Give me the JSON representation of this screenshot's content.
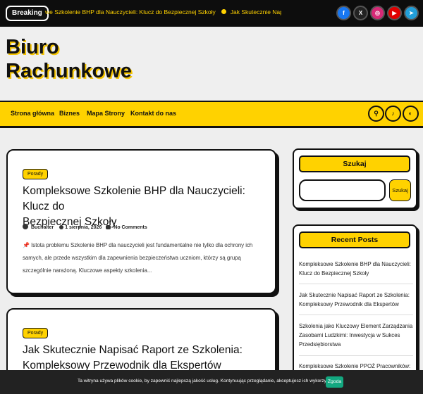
{
  "topbar": {
    "breaking_label": "Breaking",
    "ticker_items": [
      "we Szkolenie BHP dla Nauczycieli: Klucz do Bezpiecznej Szkoły",
      "Jak Skutecznie Napisać Rap"
    ],
    "socials": [
      {
        "name": "facebook",
        "glyph": "f",
        "color": "#1877f2"
      },
      {
        "name": "x",
        "glyph": "X",
        "color": "#222222"
      },
      {
        "name": "instagram",
        "glyph": "◎",
        "color": "#d62976"
      },
      {
        "name": "youtube",
        "glyph": "▶",
        "color": "#e00000"
      },
      {
        "name": "telegram",
        "glyph": "➤",
        "color": "#229ed9"
      }
    ]
  },
  "brand": {
    "title_line1": "Biuro",
    "title_line2": "Rachunkowe"
  },
  "nav": {
    "items": [
      "Strona główna",
      "Biznes",
      "Mapa Strony",
      "Kontakt do nas"
    ],
    "buttons": {
      "search": "⚲",
      "bell": "♪",
      "theme": "◐"
    }
  },
  "posts": [
    {
      "category": "Porady",
      "title_line1": "Kompleksowe Szkolenie BHP dla Nauczycieli: Klucz do",
      "title_line2": "Bezpiecznej Szkoły",
      "author": "Buchalter",
      "date": "1 sierpnia, 2026",
      "comments": "No Comments",
      "excerpt_line1": "Istota problemu Szkolenie BHP dla nauczycieli jest fundamentalne nie tylko dla ochrony ich",
      "excerpt_line2": "samych, ale przede wszystkim dla zapewnienia bezpieczeństwa uczniom, którzy są grupą",
      "excerpt_line3": "szczególnie narażoną. Kluczowe aspekty szkolenia..."
    },
    {
      "category": "Porady",
      "title_line1": "Jak Skutecznie Napisać Raport ze Szkolenia:",
      "title_line2": "Kompleksowy Przewodnik dla Ekspertów"
    }
  ],
  "sidebar": {
    "search_title": "Szukaj",
    "search_button": "Szukaj",
    "recent_title": "Recent Posts",
    "recent_items": [
      [
        "Kompleksowe Szkolenie BHP dla Nauczycieli:",
        "Klucz do Bezpiecznej Szkoły"
      ],
      [
        "Jak Skutecznie Napisać Raport ze Szkolenia:",
        "Kompleksowy Przewodnik dla Ekspertów"
      ],
      [
        "Szkolenia jako Kluczowy Element Zarządzania",
        "Zasobami Ludzkimi: Inwestycja w Sukces",
        "Przedsiębiorstwa"
      ],
      [
        "Kompleksowe Szkolenie PPOŻ Pracowników:"
      ]
    ]
  },
  "cookie": {
    "text": "Ta witryna używa plików cookie, by zapewnić najlepszą jakość usług. Kontynuując przeglądanie, akceptujesz ich wykorzystanie.",
    "accept_label": "Zgoda"
  }
}
